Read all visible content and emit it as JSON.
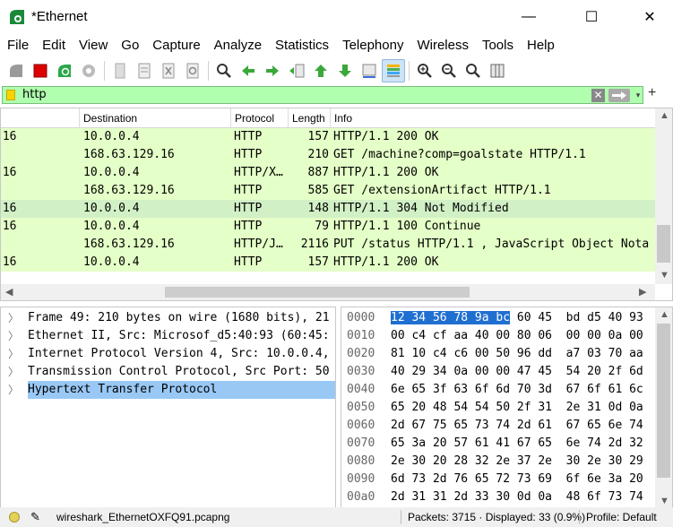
{
  "window": {
    "title": "*Ethernet",
    "minimize": "—",
    "maximize": "☐",
    "close": "✕"
  },
  "menu": [
    "File",
    "Edit",
    "View",
    "Go",
    "Capture",
    "Analyze",
    "Statistics",
    "Telephony",
    "Wireless",
    "Tools",
    "Help"
  ],
  "filter": {
    "value": "http",
    "clear": "✕",
    "dropdown": "▾",
    "add": "+"
  },
  "packet_list": {
    "columns": [
      "Destination",
      "Protocol",
      "Length",
      "Info"
    ],
    "rows": [
      {
        "source": ".16",
        "destination": "10.0.0.4",
        "protocol": "HTTP",
        "length": "157",
        "info": "HTTP/1.1 200 OK"
      },
      {
        "source": "",
        "destination": "168.63.129.16",
        "protocol": "HTTP",
        "length": "210",
        "info": "GET /machine?comp=goalstate HTTP/1.1"
      },
      {
        "source": ".16",
        "destination": "10.0.0.4",
        "protocol": "HTTP/X…",
        "length": "887",
        "info": "HTTP/1.1 200 OK"
      },
      {
        "source": "",
        "destination": "168.63.129.16",
        "protocol": "HTTP",
        "length": "585",
        "info": "GET /extensionArtifact HTTP/1.1"
      },
      {
        "source": ".16",
        "destination": "10.0.0.4",
        "protocol": "HTTP",
        "length": "148",
        "info": "HTTP/1.1 304 Not Modified"
      },
      {
        "source": ".16",
        "destination": "10.0.0.4",
        "protocol": "HTTP",
        "length": "79",
        "info": "HTTP/1.1 100 Continue"
      },
      {
        "source": "",
        "destination": "168.63.129.16",
        "protocol": "HTTP/J…",
        "length": "2116",
        "info": "PUT /status HTTP/1.1 , JavaScript Object Nota"
      },
      {
        "source": ".16",
        "destination": "10.0.0.4",
        "protocol": "HTTP",
        "length": "157",
        "info": "HTTP/1.1 200 OK"
      }
    ]
  },
  "details": [
    {
      "text": "Frame 49: 210 bytes on wire (1680 bits), 21"
    },
    {
      "text": "Ethernet II, Src: Microsof_d5:40:93 (60:45:"
    },
    {
      "text": "Internet Protocol Version 4, Src: 10.0.0.4,"
    },
    {
      "text": "Transmission Control Protocol, Src Port: 50"
    },
    {
      "text": "Hypertext Transfer Protocol"
    }
  ],
  "bytes": [
    {
      "offset": "0000",
      "hex_hl": "12 34 56 78 9a bc",
      "hex": " 60 45  bd d5 40 93"
    },
    {
      "offset": "0010",
      "hex_hl": "",
      "hex": "00 c4 cf aa 40 00 80 06  00 00 0a 00"
    },
    {
      "offset": "0020",
      "hex_hl": "",
      "hex": "81 10 c4 c6 00 50 96 dd  a7 03 70 aa"
    },
    {
      "offset": "0030",
      "hex_hl": "",
      "hex": "40 29 34 0a 00 00 47 45  54 20 2f 6d"
    },
    {
      "offset": "0040",
      "hex_hl": "",
      "hex": "6e 65 3f 63 6f 6d 70 3d  67 6f 61 6c"
    },
    {
      "offset": "0050",
      "hex_hl": "",
      "hex": "65 20 48 54 54 50 2f 31  2e 31 0d 0a"
    },
    {
      "offset": "0060",
      "hex_hl": "",
      "hex": "2d 67 75 65 73 74 2d 61  67 65 6e 74"
    },
    {
      "offset": "0070",
      "hex_hl": "",
      "hex": "65 3a 20 57 61 41 67 65  6e 74 2d 32"
    },
    {
      "offset": "0080",
      "hex_hl": "",
      "hex": "2e 30 20 28 32 2e 37 2e  30 2e 30 29"
    },
    {
      "offset": "0090",
      "hex_hl": "",
      "hex": "6d 73 2d 76 65 72 73 69  6f 6e 3a 20"
    },
    {
      "offset": "00a0",
      "hex_hl": "",
      "hex": "2d 31 31 2d 33 30 0d 0a  48 6f 73 74"
    }
  ],
  "status": {
    "file": "wireshark_EthernetOXFQ91.pcapng",
    "packets": "Packets: 3715 · Displayed: 33 (0.9%)",
    "profile": "Profile: Default"
  },
  "colors": {
    "packet_bg": "#e4ffc7",
    "filter_bg": "#afffaf",
    "selected_detail": "#99c8f5",
    "hex_highlight": "#1f6fd1"
  }
}
